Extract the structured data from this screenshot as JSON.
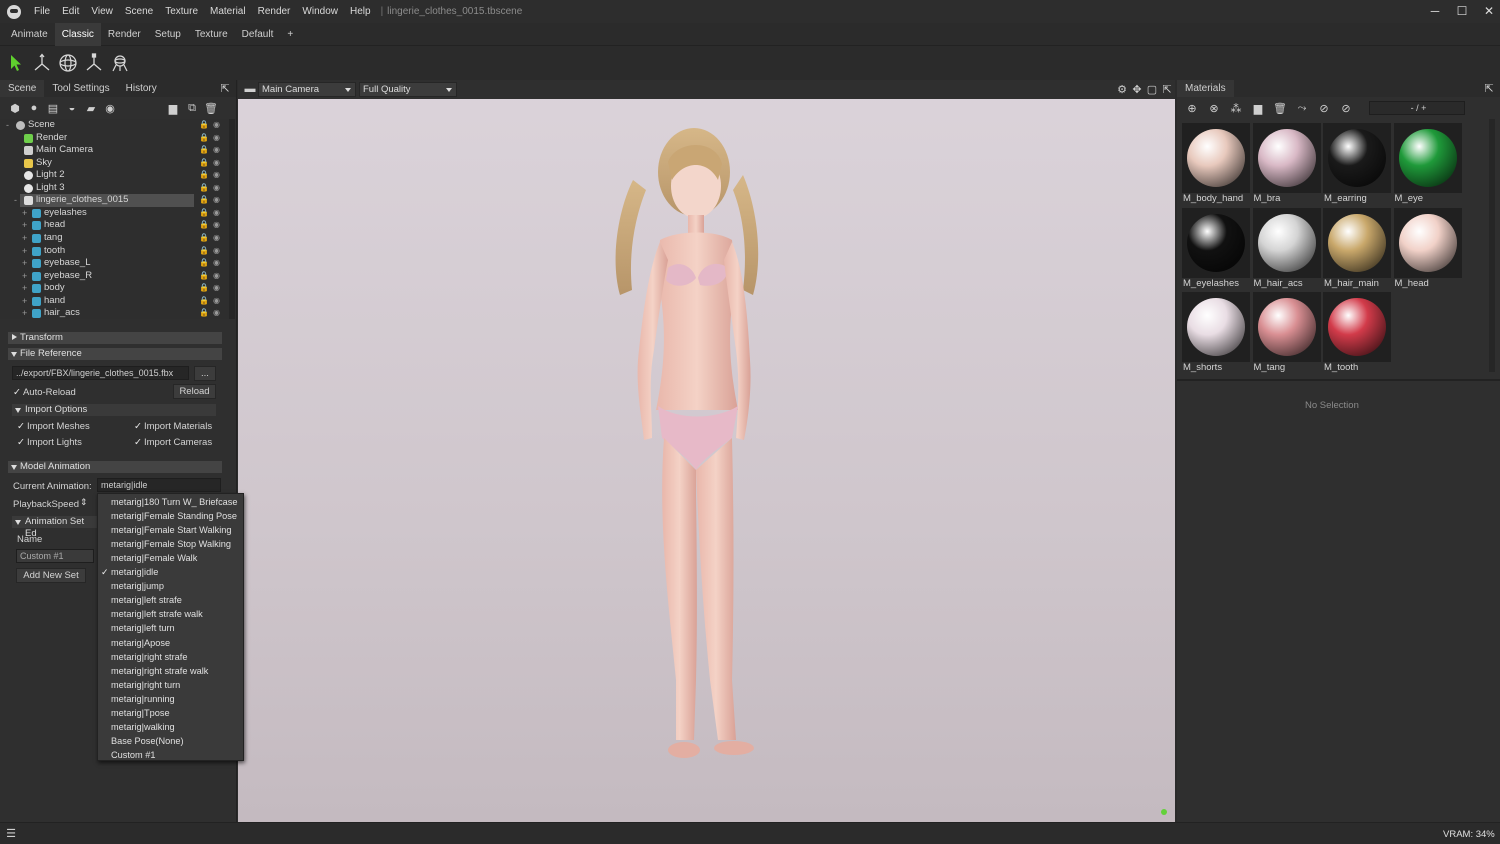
{
  "titlebar": {
    "menu": [
      "File",
      "Edit",
      "View",
      "Scene",
      "Texture",
      "Material",
      "Render",
      "Window",
      "Help"
    ],
    "separator": "|",
    "file_title": "lingerie_clothes_0015.tbscene",
    "minimize": "─",
    "maximize": "☐",
    "close": "✕"
  },
  "workspace_tabs": [
    "Animate",
    "Classic",
    "Render",
    "Setup",
    "Texture",
    "Default",
    "+"
  ],
  "toolbar": {
    "tools": [
      "select-arrow-icon",
      "translate-icon",
      "rotate-sphere-icon",
      "scale-icon",
      "camera-icon"
    ]
  },
  "left_panel": {
    "tabs": [
      "Scene",
      "Tool Settings",
      "History"
    ],
    "tree": [
      {
        "label": "Scene",
        "level": 0,
        "icon": "scene-icon",
        "expander": "-"
      },
      {
        "label": "Render",
        "level": 1,
        "icon": "render-icon",
        "expander": ""
      },
      {
        "label": "Main Camera",
        "level": 1,
        "icon": "camera-icon",
        "expander": ""
      },
      {
        "label": "Sky",
        "level": 1,
        "icon": "sky-icon",
        "expander": ""
      },
      {
        "label": "Light 2",
        "level": 1,
        "icon": "light-icon",
        "expander": ""
      },
      {
        "label": "Light 3",
        "level": 1,
        "icon": "light-icon",
        "expander": ""
      },
      {
        "label": "lingerie_clothes_0015",
        "level": 1,
        "icon": "model-icon",
        "expander": "-",
        "selected": true
      },
      {
        "label": "eyelashes",
        "level": 2,
        "icon": "mesh-icon",
        "expander": "+"
      },
      {
        "label": "head",
        "level": 2,
        "icon": "mesh-icon",
        "expander": "+"
      },
      {
        "label": "tang",
        "level": 2,
        "icon": "mesh-icon",
        "expander": "+"
      },
      {
        "label": "tooth",
        "level": 2,
        "icon": "mesh-icon",
        "expander": "+"
      },
      {
        "label": "eyebase_L",
        "level": 2,
        "icon": "mesh-icon",
        "expander": "+"
      },
      {
        "label": "eyebase_R",
        "level": 2,
        "icon": "mesh-icon",
        "expander": "+"
      },
      {
        "label": "body",
        "level": 2,
        "icon": "mesh-icon",
        "expander": "+"
      },
      {
        "label": "hand",
        "level": 2,
        "icon": "mesh-icon",
        "expander": "+"
      },
      {
        "label": "hair_acs",
        "level": 2,
        "icon": "mesh-icon",
        "expander": "+"
      }
    ],
    "properties": {
      "transform": "Transform",
      "file_reference": "File Reference",
      "file_path": "../export/FBX/lingerie_clothes_0015.fbx",
      "browse": "...",
      "auto_reload": "Auto-Reload",
      "reload": "Reload",
      "import_options": "Import Options",
      "import_meshes": "Import Meshes",
      "import_materials": "Import Materials",
      "import_lights": "Import Lights",
      "import_cameras": "Import Cameras",
      "model_animation": "Model Animation",
      "current_animation_label": "Current Animation:",
      "current_animation": "metarig|idle",
      "playback_speed_label": "PlaybackSpeed",
      "animation_set_editor": "Animation Set Ed",
      "name_label": "Name",
      "custom_set": "Custom #1",
      "add_new_set": "Add New Set"
    }
  },
  "animation_dropdown": {
    "options": [
      "metarig|180 Turn W_ Briefcase",
      "metarig|Female Standing Pose",
      "metarig|Female Start Walking",
      "metarig|Female Stop Walking",
      "metarig|Female Walk",
      "metarig|idle",
      "metarig|jump",
      "metarig|left strafe",
      "metarig|left strafe walk",
      "metarig|left turn",
      "metarig|Apose",
      "metarig|right strafe",
      "metarig|right strafe walk",
      "metarig|right turn",
      "metarig|running",
      "metarig|Tpose",
      "metarig|walking",
      "Base Pose(None)",
      "Custom #1"
    ],
    "selected": "metarig|idle",
    "check": "✓"
  },
  "viewport": {
    "camera": "Main Camera",
    "quality": "Full Quality"
  },
  "materials_panel": {
    "title": "Materials",
    "filter_text": "- / +",
    "no_selection": "No Selection",
    "materials": [
      {
        "name": "M_body_hand",
        "swatch": "#e8c9bd"
      },
      {
        "name": "M_bra",
        "swatch": "#d9b9c6"
      },
      {
        "name": "M_earring",
        "swatch": "#1a1a1a"
      },
      {
        "name": "M_eye",
        "swatch": "#1f9a3a"
      },
      {
        "name": "M_eyelashes",
        "swatch": "#111111"
      },
      {
        "name": "M_hair_acs",
        "swatch": "#d4d4d4"
      },
      {
        "name": "M_hair_main",
        "swatch": "#c9a86b"
      },
      {
        "name": "M_head",
        "swatch": "#f1d1c8"
      },
      {
        "name": "M_shorts",
        "swatch": "#e9dde4"
      },
      {
        "name": "M_tang",
        "swatch": "#d98f93"
      },
      {
        "name": "M_tooth",
        "swatch": "#d23b4a"
      }
    ]
  },
  "status": {
    "vram": "VRAM: 34%"
  }
}
